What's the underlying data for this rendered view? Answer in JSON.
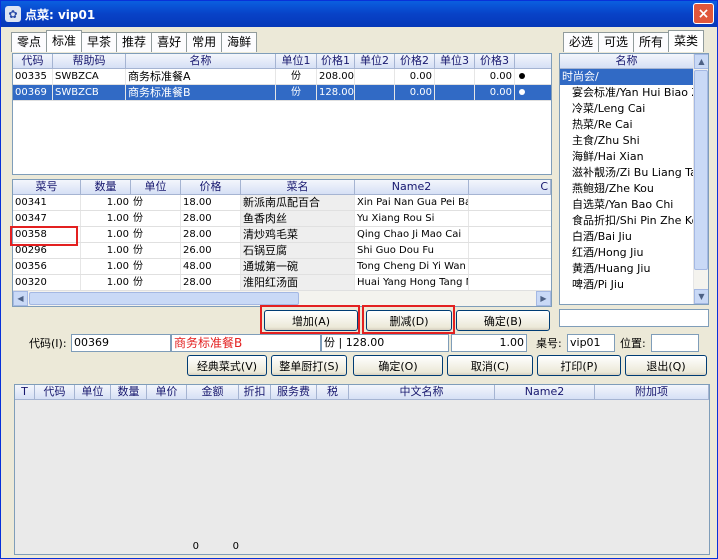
{
  "window": {
    "title": "点菜: vip01",
    "close": "×"
  },
  "top_tabs": [
    "零点",
    "标准",
    "早茶",
    "推荐",
    "喜好",
    "常用",
    "海鲜"
  ],
  "top_tabs_active": 1,
  "package_table": {
    "headers": [
      "代码",
      "帮助码",
      "名称",
      "单位1",
      "价格1",
      "单位2",
      "价格2",
      "单位3",
      "价格3"
    ],
    "rows": [
      [
        "00335",
        "SWBZCA",
        "商务标准餐A",
        "份",
        "208.00",
        "",
        "0.00",
        "",
        "0.00"
      ],
      [
        "00369",
        "SWBZCB",
        "商务标准餐B",
        "份",
        "128.00",
        "",
        "0.00",
        "",
        "0.00"
      ]
    ],
    "selected_row": 1
  },
  "dish_table": {
    "headers": [
      "菜号",
      "数量",
      "单位",
      "价格",
      "菜名",
      "Name2",
      "C"
    ],
    "rows": [
      [
        "00341",
        "1.00",
        "份",
        "18.00",
        "新派南瓜配百合",
        "Xin Pai Nan Gua Pei Bai H"
      ],
      [
        "00347",
        "1.00",
        "份",
        "28.00",
        "鱼香肉丝",
        "Yu Xiang Rou Si"
      ],
      [
        "00358",
        "1.00",
        "份",
        "28.00",
        "清炒鸡毛菜",
        "Qing Chao Ji Mao Cai"
      ],
      [
        "00296",
        "1.00",
        "份",
        "26.00",
        "石锅豆腐",
        "Shi Guo Dou Fu"
      ],
      [
        "00356",
        "1.00",
        "份",
        "48.00",
        "通城第一碗",
        "Tong Cheng Di Yi Wan"
      ],
      [
        "00320",
        "1.00",
        "份",
        "28.00",
        "淮阳红汤面",
        "Huai Yang Hong Tang Mi"
      ]
    ]
  },
  "right_tabs": [
    "必选",
    "可选",
    "所有",
    "菜类"
  ],
  "right_tabs_active": 3,
  "category_list": {
    "header": "名称",
    "items": [
      "时尚会/",
      "宴会标准/Yan Hui Biao Zh",
      "冷菜/Leng Cai",
      "热菜/Re Cai",
      "主食/Zhu Shi",
      "海鲜/Hai Xian",
      "滋补靓汤/Zi Bu Liang Tan",
      "燕鲍翅/Zhe Kou",
      "自选菜/Yan Bao Chi",
      "食品折扣/Shi Pin Zhe Kou",
      "白酒/Bai Jiu",
      "红酒/Hong Jiu",
      "黄酒/Huang Jiu",
      "啤酒/Pi Jiu"
    ],
    "selected": 0
  },
  "mid_buttons": {
    "add": "增加(A)",
    "remove": "删减(D)",
    "confirm": "确定(B)"
  },
  "form": {
    "code_label": "代码(I):",
    "code_value": "00369",
    "name_value": "商务标准餐B",
    "unit_price": "份 | 128.00",
    "qty": "1.00",
    "table_label": "桌号:",
    "table_value": "vip01",
    "position_label": "位置:",
    "position_value": ""
  },
  "action_buttons": {
    "classic": "经典菜式(V)",
    "kitchen": "整单厨打(S)",
    "ok": "确定(O)",
    "cancel": "取消(C)",
    "print": "打印(P)",
    "exit": "退出(Q)"
  },
  "order_table": {
    "headers": [
      "T",
      "代码",
      "单位",
      "数量",
      "单价",
      "金额",
      "折扣",
      "服务费",
      "税",
      "中文名称",
      "Name2",
      "附加项"
    ],
    "totals": [
      "0",
      "0"
    ]
  },
  "colors": {
    "title_bar": "#0842c7",
    "selection": "#316ac5",
    "highlight_box": "#e32020"
  }
}
